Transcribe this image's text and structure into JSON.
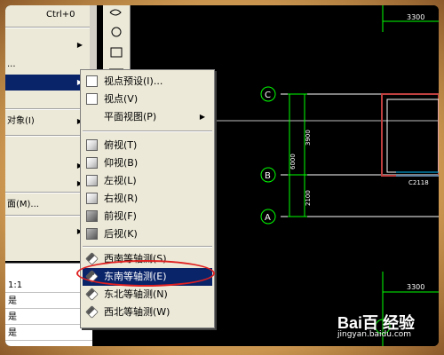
{
  "parent_menu": {
    "shortcut_row": "Ctrl+0",
    "dots_row": "...",
    "object_row": "对象(I)",
    "face_row": "面(M)...",
    "items_count_hint": ""
  },
  "submenu": {
    "items": [
      {
        "label": "视点预设(I)...",
        "icon": "viewpoint-preset-icon"
      },
      {
        "label": "视点(V)",
        "icon": "viewpoint-icon"
      },
      {
        "label": "平面视图(P)",
        "icon": "",
        "has_submenu": true
      },
      {
        "label": "俯视(T)",
        "icon": "top-view-icon"
      },
      {
        "label": "仰视(B)",
        "icon": "bottom-view-icon"
      },
      {
        "label": "左视(L)",
        "icon": "left-view-icon"
      },
      {
        "label": "右视(R)",
        "icon": "right-view-icon"
      },
      {
        "label": "前视(F)",
        "icon": "front-view-icon"
      },
      {
        "label": "后视(K)",
        "icon": "back-view-icon"
      },
      {
        "label": "西南等轴测(S)",
        "icon": "sw-isometric-icon"
      },
      {
        "label": "东南等轴测(E)",
        "icon": "se-isometric-icon",
        "highlighted": true
      },
      {
        "label": "东北等轴测(N)",
        "icon": "ne-isometric-icon"
      },
      {
        "label": "西北等轴测(W)",
        "icon": "nw-isometric-icon"
      }
    ]
  },
  "properties": {
    "rows": [
      "1:1",
      "是",
      "是",
      "是"
    ]
  },
  "drawing": {
    "grid_labels": [
      "C",
      "B",
      "A"
    ],
    "dims": [
      "3300",
      "3900",
      "2100",
      "6000",
      "3300"
    ],
    "window_tag": "C2118"
  },
  "watermark": {
    "logo": "Bai百 经验",
    "url": "jingyan.baidu.com"
  },
  "colors": {
    "menu_bg": "#ece9d8",
    "highlight": "#0a246a",
    "annotation": "#e02020",
    "cad_green": "#00ff00",
    "cad_white": "#ffffff"
  }
}
